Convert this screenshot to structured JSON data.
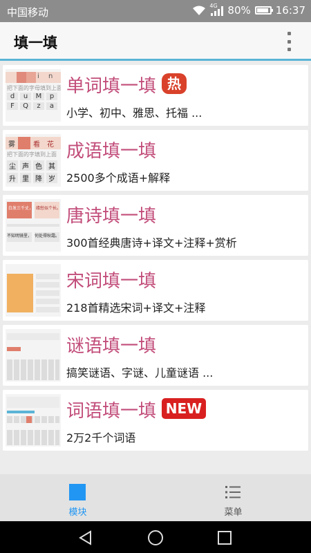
{
  "status_bar": {
    "carrier": "中国移动",
    "network": "4G",
    "battery": "80%",
    "battery_level": 0.8,
    "time": "16:37"
  },
  "app_bar": {
    "title": "填一填",
    "menu_icon": "more-vert-icon"
  },
  "items": [
    {
      "title": "单词填一填",
      "subtitle": "小学、初中、雅思、托福 ...",
      "badge": "热"
    },
    {
      "title": "成语填一填",
      "subtitle": "2500多个成语+解释",
      "badge": ""
    },
    {
      "title": "唐诗填一填",
      "subtitle": "300首经典唐诗+译文+注释+赏析",
      "badge": ""
    },
    {
      "title": "宋词填一填",
      "subtitle": "218首精选宋词+译文+注释",
      "badge": ""
    },
    {
      "title": "谜语填一填",
      "subtitle": "搞笑谜语、字谜、儿童谜语 ...",
      "badge": ""
    },
    {
      "title": "词语填一填",
      "subtitle": "2万2千个词语",
      "badge": "NEW"
    }
  ],
  "bottom_nav": [
    {
      "label": "模块",
      "icon": "module-square-icon",
      "active": true
    },
    {
      "label": "菜单",
      "icon": "list-menu-icon",
      "active": false
    }
  ],
  "thumbnails": {
    "word": {
      "letters": [
        "i",
        "n"
      ],
      "caption": "把下面的字母填到上面",
      "grid": [
        "d",
        "u",
        "M",
        "p",
        "F",
        "Q",
        "z",
        "a"
      ]
    },
    "idiom": {
      "chars": [
        "雾",
        "看",
        "花"
      ],
      "caption": "把下面的字填到上面",
      "grid": [
        "尘",
        "声",
        "色",
        "其",
        "升",
        "里",
        "降",
        "岁"
      ]
    },
    "tang": {
      "lines": [
        "白发三千丈，",
        "缘愁似个长。",
        "不知明镜里，",
        "何处得秋霜。"
      ]
    }
  },
  "colors": {
    "title": "#c24d7a",
    "accent": "#2196f3",
    "hot": "#d9412a",
    "new": "#d92020",
    "appbar_line": "#5ab4d6"
  }
}
